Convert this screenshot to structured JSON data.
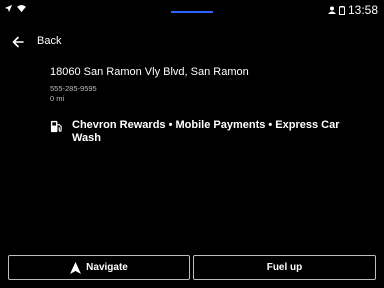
{
  "status": {
    "time": "13:58",
    "icons": [
      "navigation-arrow-icon",
      "wifi-icon",
      "profile-icon",
      "battery-icon"
    ]
  },
  "header": {
    "back_label": "Back"
  },
  "place": {
    "address": "18060 San Ramon Vly Blvd, San Ramon",
    "phone": "555-285-9595",
    "distance": "0 mi",
    "amenities": "Chevron Rewards • Mobile Payments • Express Car Wash"
  },
  "actions": {
    "navigate_label": "Navigate",
    "fuel_label": "Fuel up"
  },
  "colors": {
    "accent": "#2962ff",
    "border": "#bdbdbd"
  }
}
